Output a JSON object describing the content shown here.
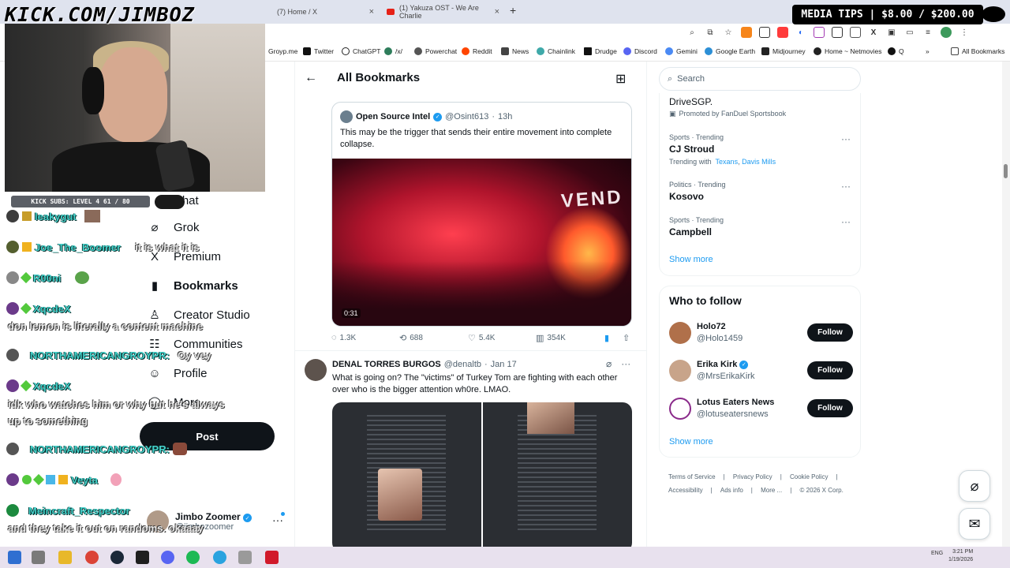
{
  "browser": {
    "tabs": [
      {
        "label": "(7) Home / X"
      },
      {
        "label": "(1) Yakuza OST - We Are Charlie"
      }
    ],
    "bookmarks": [
      "Groyp.me",
      "Twitter",
      "ChatGPT",
      "/x/",
      "Powerchat",
      "Reddit",
      "News",
      "Chainlink",
      "Drudge",
      "Discord",
      "Gemini",
      "Google Earth",
      "Midjourney",
      "Home ~ Netmovies",
      "Q",
      "All Bookmarks"
    ]
  },
  "overlay": {
    "logo": "KICK.COM/JIMBOZ",
    "subs_badge": "KICK SUBS: LEVEL 4 61 / 80",
    "media_tips": "MEDIA TIPS | $8.00 / $200.00",
    "chat": [
      {
        "user": "leakygut",
        "msg": ""
      },
      {
        "user": "Joe_The_Boomer",
        "msg": "it is what it is"
      },
      {
        "user": "R00ni",
        "msg": ""
      },
      {
        "user": "XqcdeX",
        "msg": ""
      },
      {
        "text": "don lemon is literally a content machine"
      },
      {
        "user": "NORTHAMERICANGROYPR:",
        "msg": "Oy vey"
      },
      {
        "user": "XqcdeX",
        "msg": ""
      },
      {
        "text": "idk who watches him or why but he's always"
      },
      {
        "text": "up to something"
      },
      {
        "user": "NORTHAMERICANGROYPR:",
        "msg": ""
      },
      {
        "user": "Veyta",
        "msg": ""
      },
      {
        "user": "Meincraft_Respector",
        "msg": ""
      },
      {
        "text": "and they take it out on randoms. okaaay"
      }
    ]
  },
  "leftnav": {
    "items": [
      "Chat",
      "Grok",
      "Premium",
      "Bookmarks",
      "Creator Studio",
      "Communities",
      "Profile",
      "More"
    ],
    "post_label": "Post",
    "account_name": "Jimbo Zoomer",
    "account_handle": "@jimbozoomer"
  },
  "main": {
    "title": "All Bookmarks",
    "quote": {
      "name": "Open Source Intel",
      "handle": "@Osint613",
      "time": "13h",
      "text": "This may be the trigger that sends their entire movement into complete collapse.",
      "video_sign": "VEND",
      "duration": "0:31"
    },
    "actions": {
      "replies": "1.3K",
      "reposts": "688",
      "likes": "5.4K",
      "views": "354K"
    },
    "tweet2": {
      "name": "DENAL TORRES BURGOS",
      "handle": "@denaltb",
      "time": "Jan 17",
      "text": "What is going on? The \"victims\" of Turkey Tom are fighting with each other over who is the bigger attention wh0re. LMAO."
    }
  },
  "sidebar": {
    "search_placeholder": "Search",
    "promo_title": "DriveSGP.",
    "promo_by": "Promoted by FanDuel Sportsbook",
    "trends": [
      {
        "category": "Sports · Trending",
        "topic": "CJ Stroud",
        "with_label": "Trending with",
        "with": [
          "Texans",
          "Davis Mills"
        ]
      },
      {
        "category": "Politics · Trending",
        "topic": "Kosovo"
      },
      {
        "category": "Sports · Trending",
        "topic": "Campbell"
      }
    ],
    "show_more": "Show more",
    "who_to_follow": "Who to follow",
    "follow": [
      {
        "name": "Holo72",
        "handle": "@Holo1459",
        "verified": false
      },
      {
        "name": "Erika Kirk",
        "handle": "@MrsErikaKirk",
        "verified": true
      },
      {
        "name": "Lotus Eaters News",
        "handle": "@lotuseatersnews",
        "verified": false
      }
    ],
    "follow_label": "Follow",
    "footer": [
      "Terms of Service",
      "Privacy Policy",
      "Cookie Policy",
      "Accessibility",
      "Ads info",
      "More ...",
      "© 2026 X Corp."
    ]
  },
  "taskbar": {
    "lang": "ENG",
    "time": "3:21 PM",
    "date": "1/19/2026"
  },
  "colors": {
    "accent": "#1d9bf0",
    "chat_name": "#45d0c9",
    "text": "#0f1419",
    "muted": "#536471"
  }
}
